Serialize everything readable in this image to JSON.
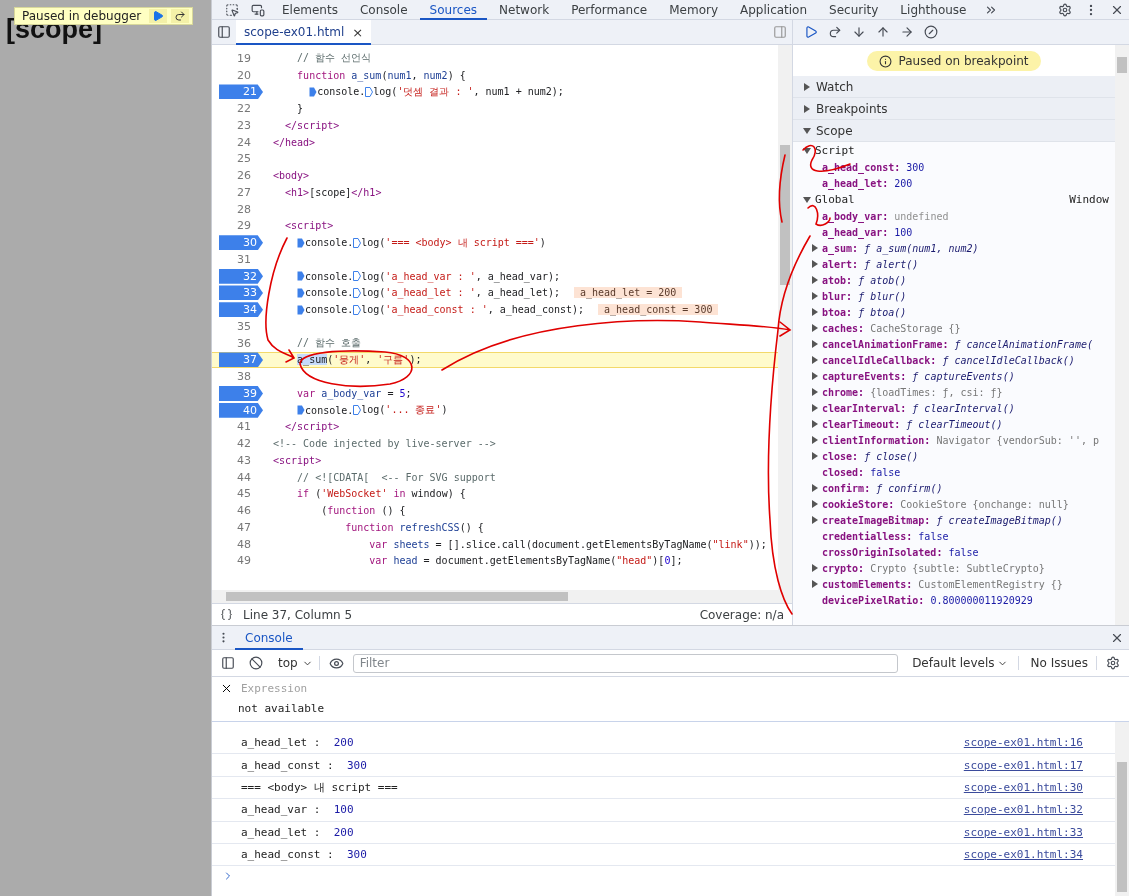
{
  "page": {
    "heading": "[scope]",
    "paused_overlay": {
      "label": "Paused in debugger"
    }
  },
  "devtools": {
    "tabs": [
      {
        "label": "Elements",
        "selected": false
      },
      {
        "label": "Console",
        "selected": false
      },
      {
        "label": "Sources",
        "selected": true
      },
      {
        "label": "Network",
        "selected": false
      },
      {
        "label": "Performance",
        "selected": false
      },
      {
        "label": "Memory",
        "selected": false
      },
      {
        "label": "Application",
        "selected": false
      },
      {
        "label": "Security",
        "selected": false
      },
      {
        "label": "Lighthouse",
        "selected": false
      }
    ]
  },
  "editor": {
    "file_tab": {
      "label": "scope-ex01.html",
      "close": "×"
    },
    "lines": [
      {
        "number": "19",
        "breakpoint": false,
        "paused": false,
        "tokens": [
          {
            "kind": "comment",
            "text": "    // 함수 선언식"
          }
        ]
      },
      {
        "number": "20",
        "breakpoint": false,
        "paused": false,
        "tokens": [
          {
            "kind": "keyword",
            "text": "    function "
          },
          {
            "kind": "def",
            "text": "a_sum"
          },
          {
            "kind": "plain",
            "text": "("
          },
          {
            "kind": "def",
            "text": "num1"
          },
          {
            "kind": "plain",
            "text": ", "
          },
          {
            "kind": "def",
            "text": "num2"
          },
          {
            "kind": "plain",
            "text": ") {"
          }
        ]
      },
      {
        "number": "21",
        "breakpoint": true,
        "paused": false,
        "tokens": [
          {
            "kind": "plain",
            "text": "      console.",
            "breakpoint_marker": {
              "active": true
            }
          },
          {
            "kind": "plain",
            "text": "log(",
            "breakpoint_marker": {
              "active": false
            }
          },
          {
            "kind": "string",
            "text": "'덧셈 결과 : '"
          },
          {
            "kind": "plain",
            "text": ", num1 + num2);"
          }
        ]
      },
      {
        "number": "22",
        "breakpoint": false,
        "paused": false,
        "tokens": [
          {
            "kind": "plain",
            "text": "    }"
          }
        ]
      },
      {
        "number": "23",
        "breakpoint": false,
        "paused": false,
        "tokens": [
          {
            "kind": "tag",
            "text": "  </script>"
          }
        ]
      },
      {
        "number": "24",
        "breakpoint": false,
        "paused": false,
        "tokens": [
          {
            "kind": "tag",
            "text": "</head>"
          }
        ]
      },
      {
        "number": "25",
        "breakpoint": false,
        "paused": false
      },
      {
        "number": "26",
        "breakpoint": false,
        "paused": false,
        "tokens": [
          {
            "kind": "tag",
            "text": "<body>"
          }
        ]
      },
      {
        "number": "27",
        "breakpoint": false,
        "paused": false,
        "tokens": [
          {
            "kind": "tag",
            "text": "  <h1>"
          },
          {
            "kind": "plain",
            "text": "[scope]"
          },
          {
            "kind": "tag",
            "text": "</h1>"
          }
        ]
      },
      {
        "number": "28",
        "breakpoint": false,
        "paused": false
      },
      {
        "number": "29",
        "breakpoint": false,
        "paused": false,
        "tokens": [
          {
            "kind": "tag",
            "text": "  <script>"
          }
        ]
      },
      {
        "number": "30",
        "breakpoint": true,
        "paused": false,
        "tokens": [
          {
            "kind": "plain",
            "text": "    console.",
            "breakpoint_marker": {
              "active": true
            }
          },
          {
            "kind": "plain",
            "text": "log(",
            "breakpoint_marker": {
              "active": false
            }
          },
          {
            "kind": "string",
            "text": "'=== <body> 내 script ==='"
          },
          {
            "kind": "plain",
            "text": ")"
          }
        ]
      },
      {
        "number": "31",
        "breakpoint": false,
        "paused": false
      },
      {
        "number": "32",
        "breakpoint": true,
        "paused": false,
        "tokens": [
          {
            "kind": "plain",
            "text": "    console.",
            "breakpoint_marker": {
              "active": true
            }
          },
          {
            "kind": "plain",
            "text": "log(",
            "breakpoint_marker": {
              "active": false
            }
          },
          {
            "kind": "string",
            "text": "'a_head_var : '"
          },
          {
            "kind": "plain",
            "text": ", a_head_var);"
          }
        ]
      },
      {
        "number": "33",
        "breakpoint": true,
        "paused": false,
        "inline_value": "a_head_let = 200",
        "tokens": [
          {
            "kind": "plain",
            "text": "    console.",
            "breakpoint_marker": {
              "active": true
            }
          },
          {
            "kind": "plain",
            "text": "log(",
            "breakpoint_marker": {
              "active": false
            }
          },
          {
            "kind": "string",
            "text": "'a_head_let : '"
          },
          {
            "kind": "plain",
            "text": ", a_head_let);"
          }
        ]
      },
      {
        "number": "34",
        "breakpoint": true,
        "paused": false,
        "inline_value": "a_head_const = 300",
        "tokens": [
          {
            "kind": "plain",
            "text": "    console.",
            "breakpoint_marker": {
              "active": true
            }
          },
          {
            "kind": "plain",
            "text": "log(",
            "breakpoint_marker": {
              "active": false
            }
          },
          {
            "kind": "string",
            "text": "'a_head_const : '"
          },
          {
            "kind": "plain",
            "text": ", a_head_const);"
          }
        ]
      },
      {
        "number": "35",
        "breakpoint": false,
        "paused": false
      },
      {
        "number": "36",
        "breakpoint": false,
        "paused": false,
        "tokens": [
          {
            "kind": "comment",
            "text": "    // 함수 호출"
          }
        ]
      },
      {
        "number": "37",
        "breakpoint": true,
        "paused": true,
        "tokens": [
          {
            "kind": "selected",
            "text": "    a_sum"
          },
          {
            "kind": "plain",
            "text": "("
          },
          {
            "kind": "string",
            "text": "'뭉게'"
          },
          {
            "kind": "plain",
            "text": ", "
          },
          {
            "kind": "string",
            "text": "'구름'"
          },
          {
            "kind": "plain",
            "text": ");"
          }
        ]
      },
      {
        "number": "38",
        "breakpoint": false,
        "paused": false
      },
      {
        "number": "39",
        "breakpoint": true,
        "paused": false,
        "tokens": [
          {
            "kind": "keyword",
            "text": "    var "
          },
          {
            "kind": "def",
            "text": "a_body_var"
          },
          {
            "kind": "plain",
            "text": " = "
          },
          {
            "kind": "number",
            "text": "5"
          },
          {
            "kind": "plain",
            "text": ";"
          }
        ]
      },
      {
        "number": "40",
        "breakpoint": true,
        "paused": false,
        "tokens": [
          {
            "kind": "plain",
            "text": "    console.",
            "breakpoint_marker": {
              "active": true
            }
          },
          {
            "kind": "plain",
            "text": "log(",
            "breakpoint_marker": {
              "active": false
            }
          },
          {
            "kind": "string",
            "text": "'... 종료'"
          },
          {
            "kind": "plain",
            "text": ")"
          }
        ]
      },
      {
        "number": "41",
        "breakpoint": false,
        "paused": false,
        "tokens": [
          {
            "kind": "tag",
            "text": "  </script>"
          }
        ]
      },
      {
        "number": "42",
        "breakpoint": false,
        "paused": false,
        "tokens": [
          {
            "kind": "comment",
            "text": "<!-- Code injected by live-server -->"
          }
        ]
      },
      {
        "number": "43",
        "breakpoint": false,
        "paused": false,
        "tokens": [
          {
            "kind": "tag",
            "text": "<script>"
          }
        ]
      },
      {
        "number": "44",
        "breakpoint": false,
        "paused": false,
        "tokens": [
          {
            "kind": "comment",
            "text": "    // <![CDATA[  <-- For SVG support"
          }
        ]
      },
      {
        "number": "45",
        "breakpoint": false,
        "paused": false,
        "tokens": [
          {
            "kind": "keyword",
            "text": "    if"
          },
          {
            "kind": "plain",
            "text": " ("
          },
          {
            "kind": "string",
            "text": "'WebSocket'"
          },
          {
            "kind": "keyword",
            "text": " in"
          },
          {
            "kind": "plain",
            "text": " window) {"
          }
        ]
      },
      {
        "number": "46",
        "breakpoint": false,
        "paused": false,
        "tokens": [
          {
            "kind": "plain",
            "text": "        ("
          },
          {
            "kind": "keyword",
            "text": "function"
          },
          {
            "kind": "plain",
            "text": " () {"
          }
        ]
      },
      {
        "number": "47",
        "breakpoint": false,
        "paused": false,
        "tokens": [
          {
            "kind": "keyword",
            "text": "            function "
          },
          {
            "kind": "def",
            "text": "refreshCSS"
          },
          {
            "kind": "plain",
            "text": "() {"
          }
        ]
      },
      {
        "number": "48",
        "breakpoint": false,
        "paused": false,
        "tokens": [
          {
            "kind": "keyword",
            "text": "                var "
          },
          {
            "kind": "def",
            "text": "sheets"
          },
          {
            "kind": "plain",
            "text": " = [].slice.call(document.getElementsByTagName("
          },
          {
            "kind": "string",
            "text": "\"link\""
          },
          {
            "kind": "plain",
            "text": "));"
          }
        ]
      },
      {
        "number": "49",
        "breakpoint": false,
        "paused": false,
        "tokens": [
          {
            "kind": "keyword",
            "text": "                var "
          },
          {
            "kind": "def",
            "text": "head"
          },
          {
            "kind": "plain",
            "text": " = document.getElementsByTagName("
          },
          {
            "kind": "string",
            "text": "\"head\""
          },
          {
            "kind": "plain",
            "text": ")["
          },
          {
            "kind": "number",
            "text": "0"
          },
          {
            "kind": "plain",
            "text": "];"
          }
        ]
      }
    ],
    "status_bar": {
      "position": "Line 37, Column 5",
      "coverage": "Coverage: n/a"
    }
  },
  "debugger": {
    "banner": "Paused on breakpoint",
    "sections": [
      {
        "label": "Watch",
        "expanded": false
      },
      {
        "label": "Breakpoints",
        "expanded": false
      },
      {
        "label": "Scope",
        "expanded": true
      }
    ],
    "scope": [
      {
        "label": "Script",
        "expanded": true,
        "children": [
          {
            "name": "a_head_const:",
            "value": "300",
            "kind": "number",
            "expandable": false
          },
          {
            "name": "a_head_let:",
            "value": "200",
            "kind": "number",
            "expandable": false
          }
        ]
      },
      {
        "label": "Global",
        "detail": "Window",
        "expanded": true,
        "children": [
          {
            "name": "a_body_var:",
            "value": "undefined",
            "kind": "undefined",
            "expandable": false
          },
          {
            "name": "a_head_var:",
            "value": "100",
            "kind": "number",
            "expandable": false
          },
          {
            "name": "a_sum:",
            "value": "ƒ a_sum(num1, num2)",
            "kind": "function",
            "expandable": true
          },
          {
            "name": "alert:",
            "value": "ƒ alert()",
            "kind": "function",
            "expandable": true
          },
          {
            "name": "atob:",
            "value": "ƒ atob()",
            "kind": "function",
            "expandable": true
          },
          {
            "name": "blur:",
            "value": "ƒ blur()",
            "kind": "function",
            "expandable": true
          },
          {
            "name": "btoa:",
            "value": "ƒ btoa()",
            "kind": "function",
            "expandable": true
          },
          {
            "name": "caches:",
            "value": "CacheStorage {}",
            "kind": "object",
            "expandable": true
          },
          {
            "name": "cancelAnimationFrame:",
            "value": "ƒ cancelAnimationFrame(",
            "kind": "function",
            "expandable": true
          },
          {
            "name": "cancelIdleCallback:",
            "value": "ƒ cancelIdleCallback()",
            "kind": "function",
            "expandable": true
          },
          {
            "name": "captureEvents:",
            "value": "ƒ captureEvents()",
            "kind": "function",
            "expandable": true
          },
          {
            "name": "chrome:",
            "value": "{loadTimes: ƒ, csi: ƒ}",
            "kind": "object",
            "expandable": true
          },
          {
            "name": "clearInterval:",
            "value": "ƒ clearInterval()",
            "kind": "function",
            "expandable": true
          },
          {
            "name": "clearTimeout:",
            "value": "ƒ clearTimeout()",
            "kind": "function",
            "expandable": true
          },
          {
            "name": "clientInformation:",
            "value": "Navigator {vendorSub: '', p",
            "kind": "object",
            "expandable": true
          },
          {
            "name": "close:",
            "value": "ƒ close()",
            "kind": "function",
            "expandable": true
          },
          {
            "name": "closed:",
            "value": "false",
            "kind": "boolean",
            "expandable": false
          },
          {
            "name": "confirm:",
            "value": "ƒ confirm()",
            "kind": "function",
            "expandable": true
          },
          {
            "name": "cookieStore:",
            "value": "CookieStore {onchange: null}",
            "kind": "object",
            "expandable": true
          },
          {
            "name": "createImageBitmap:",
            "value": "ƒ createImageBitmap()",
            "kind": "function",
            "expandable": true
          },
          {
            "name": "credentialless:",
            "value": "false",
            "kind": "boolean",
            "expandable": false
          },
          {
            "name": "crossOriginIsolated:",
            "value": "false",
            "kind": "boolean",
            "expandable": false
          },
          {
            "name": "crypto:",
            "value": "Crypto {subtle: SubtleCrypto}",
            "kind": "object",
            "expandable": true
          },
          {
            "name": "customElements:",
            "value": "CustomElementRegistry {}",
            "kind": "object",
            "expandable": true
          },
          {
            "name": "devicePixelRatio:",
            "value": "0.800000011920929",
            "kind": "number",
            "expandable": false
          }
        ]
      }
    ]
  },
  "console": {
    "tab": "Console",
    "context": "top",
    "filter_placeholder": "Filter",
    "levels": "Default levels",
    "issues": "No Issues",
    "expression": {
      "placeholder": "Expression",
      "result": "not available"
    },
    "logs": [
      {
        "message": "a_head_let : ",
        "value": "200",
        "source": "scope-ex01.html:16"
      },
      {
        "message": "a_head_const : ",
        "value": "300",
        "source": "scope-ex01.html:17"
      },
      {
        "message": "=== <body> 내 script ===",
        "source": "scope-ex01.html:30"
      },
      {
        "message": "a_head_var : ",
        "value": "100",
        "source": "scope-ex01.html:32"
      },
      {
        "message": "a_head_let : ",
        "value": "200",
        "source": "scope-ex01.html:33"
      },
      {
        "message": "a_head_const : ",
        "value": "300",
        "source": "scope-ex01.html:34"
      }
    ]
  }
}
